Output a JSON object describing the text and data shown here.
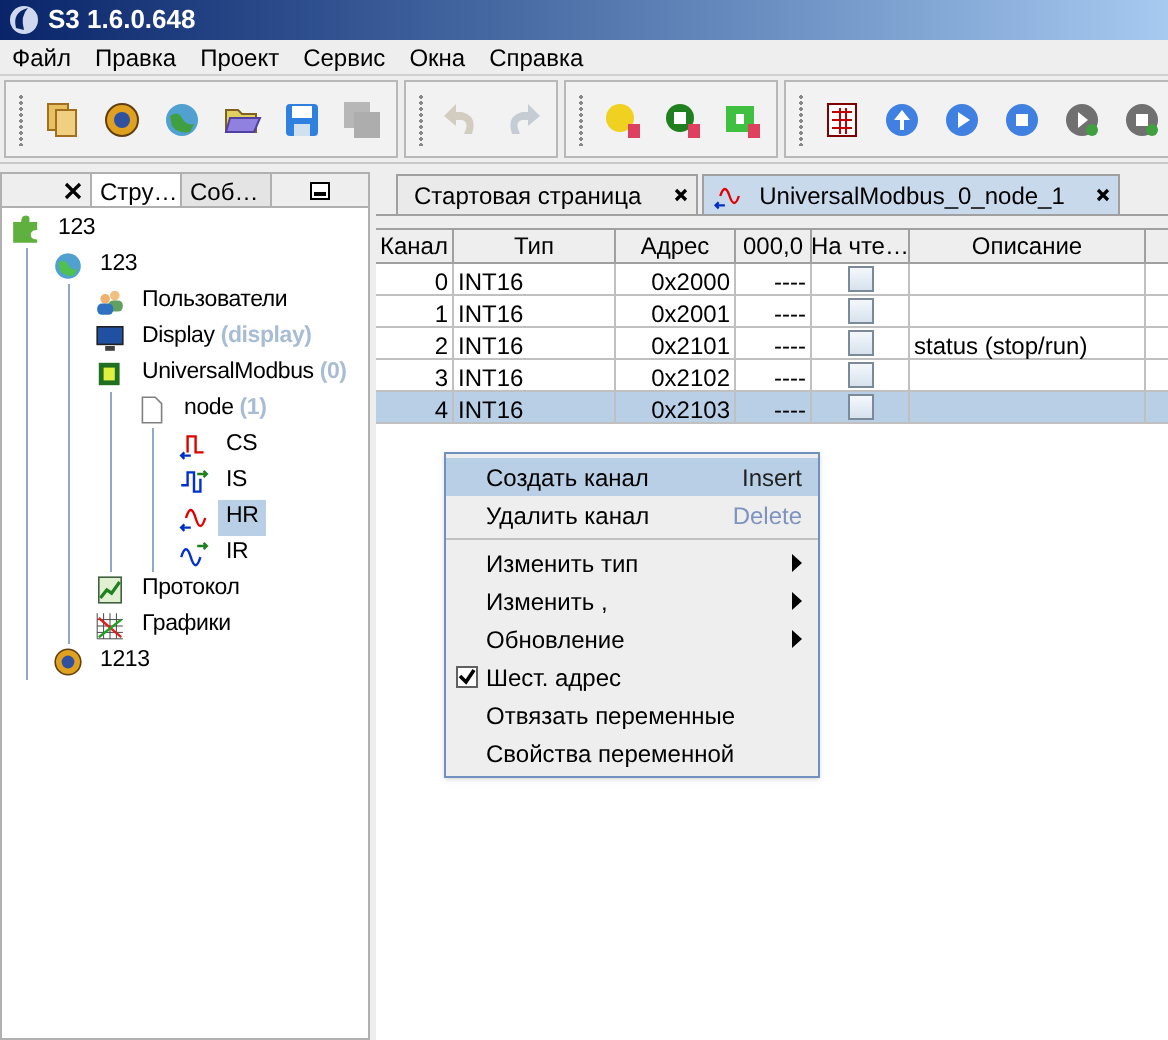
{
  "window": {
    "title": "S3 1.6.0.648"
  },
  "menu": [
    "Файл",
    "Правка",
    "Проект",
    "Сервис",
    "Окна",
    "Справка"
  ],
  "toolbar": [
    [
      {
        "kind": "new",
        "disabled": false
      },
      {
        "kind": "gear",
        "disabled": false
      },
      {
        "kind": "globe",
        "disabled": false
      },
      {
        "kind": "open",
        "disabled": false
      },
      {
        "kind": "save",
        "disabled": false
      },
      {
        "kind": "saveall",
        "disabled": true
      }
    ],
    [
      {
        "kind": "undo",
        "disabled": true
      },
      {
        "kind": "redo",
        "disabled": true
      }
    ],
    [
      {
        "kind": "dbyellow",
        "disabled": false
      },
      {
        "kind": "dbgreen",
        "disabled": false
      },
      {
        "kind": "dblock",
        "disabled": false
      }
    ],
    [
      {
        "kind": "table",
        "disabled": false
      },
      {
        "kind": "up",
        "disabled": false
      },
      {
        "kind": "play",
        "disabled": false
      },
      {
        "kind": "stop",
        "disabled": false
      },
      {
        "kind": "greyplay",
        "disabled": false
      },
      {
        "kind": "greystop",
        "disabled": false
      }
    ]
  ],
  "side_panel": {
    "tabs": [
      {
        "label": "Стру…",
        "selected": true
      },
      {
        "label": "Соб…",
        "selected": false
      }
    ],
    "tree": [
      {
        "kind": "project",
        "label": "123",
        "selected": false,
        "children": [
          {
            "kind": "station",
            "label": "123",
            "selected": false,
            "children": [
              {
                "kind": "users",
                "label": "Пользователи",
                "selected": false
              },
              {
                "kind": "display",
                "label": "Display",
                "suffix": "(display)",
                "selected": false
              },
              {
                "kind": "driver",
                "label": "UniversalModbus",
                "suffix": "(0)",
                "selected": false,
                "children": [
                  {
                    "kind": "node",
                    "label": "node",
                    "suffix": "(1)",
                    "selected": false,
                    "children": [
                      {
                        "kind": "cs",
                        "label": "CS",
                        "selected": false
                      },
                      {
                        "kind": "is",
                        "label": "IS",
                        "selected": false
                      },
                      {
                        "kind": "hr",
                        "label": "HR",
                        "selected": true
                      },
                      {
                        "kind": "ir",
                        "label": "IR",
                        "selected": false
                      }
                    ]
                  }
                ]
              },
              {
                "kind": "log",
                "label": "Протокол",
                "selected": false
              },
              {
                "kind": "chart",
                "label": "Графики",
                "selected": false
              }
            ]
          },
          {
            "kind": "gear",
            "label": "1213",
            "selected": false
          }
        ]
      }
    ]
  },
  "doc_tabs": [
    {
      "label": "Стартовая страница",
      "selected": false,
      "icon": false
    },
    {
      "label": "UniversalModbus_0_node_1",
      "selected": true,
      "icon": true
    }
  ],
  "table": {
    "columns": [
      "Канал",
      "Тип",
      "Адрес",
      "000,0",
      "На чте…",
      "Описание"
    ],
    "rows": [
      {
        "channel": "0",
        "type": "INT16",
        "address": "0x2000",
        "value": "----",
        "read": false,
        "description": "",
        "selected": false
      },
      {
        "channel": "1",
        "type": "INT16",
        "address": "0x2001",
        "value": "----",
        "read": false,
        "description": "",
        "selected": false
      },
      {
        "channel": "2",
        "type": "INT16",
        "address": "0x2101",
        "value": "----",
        "read": false,
        "description": "status (stop/run)",
        "selected": false
      },
      {
        "channel": "3",
        "type": "INT16",
        "address": "0x2102",
        "value": "----",
        "read": false,
        "description": "",
        "selected": false
      },
      {
        "channel": "4",
        "type": "INT16",
        "address": "0x2103",
        "value": "----",
        "read": false,
        "description": "",
        "selected": true
      }
    ]
  },
  "context_menu": [
    {
      "kind": "item",
      "label": "Создать канал",
      "shortcut": "Insert",
      "selected": true
    },
    {
      "kind": "item",
      "label": "Удалить канал",
      "shortcut": "Delete",
      "selected": false
    },
    {
      "kind": "separator"
    },
    {
      "kind": "submenu",
      "label": "Изменить тип",
      "selected": false
    },
    {
      "kind": "submenu",
      "label": "Изменить ,",
      "selected": false
    },
    {
      "kind": "submenu",
      "label": "Обновление",
      "selected": false
    },
    {
      "kind": "check",
      "label": "Шест. адрес",
      "checked": true,
      "selected": false
    },
    {
      "kind": "item",
      "label": "Отвязать переменные",
      "selected": false
    },
    {
      "kind": "item",
      "label": "Свойства переменной",
      "selected": false
    }
  ]
}
